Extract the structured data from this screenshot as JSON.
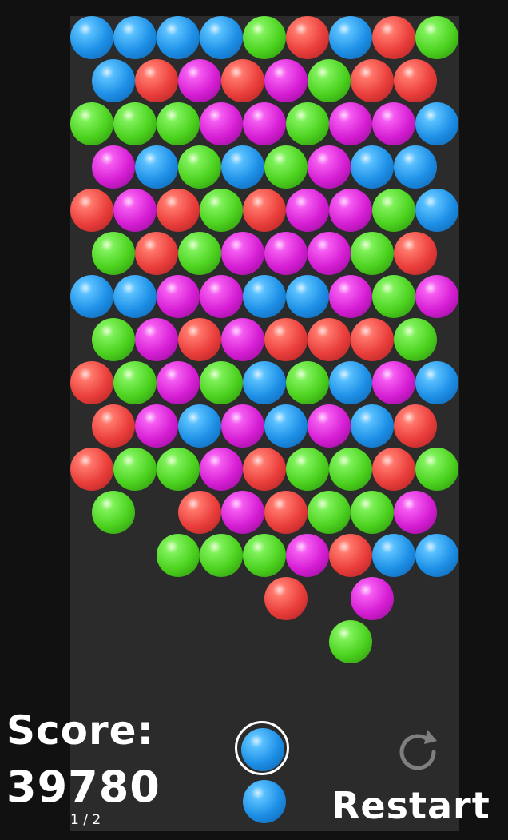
{
  "colors": {
    "B": "blue",
    "R": "red",
    "G": "green",
    "M": "magenta"
  },
  "grid": [
    "BBBBGRBRG",
    "BRMRMGRR",
    "GGGMMGMMB",
    "MBGBGMBB",
    "RMRGRMMGB",
    "GRGMMMGR",
    "BBMMBBMGM",
    "GMRMRRRG",
    "RGMGBGBMB",
    "RMBMBMBR",
    "RGGMRGGRG",
    "G.RMRGGM",
    "..GGGMRBB",
    "....R.M.",
    "......G.."
  ],
  "score": {
    "label": "Score:",
    "value": "39780"
  },
  "current_bubble_color": "blue",
  "next_bubble_color": "blue",
  "restart": {
    "label": "Restart",
    "icon": "refresh-icon"
  },
  "page_indicator": "1 / 2"
}
